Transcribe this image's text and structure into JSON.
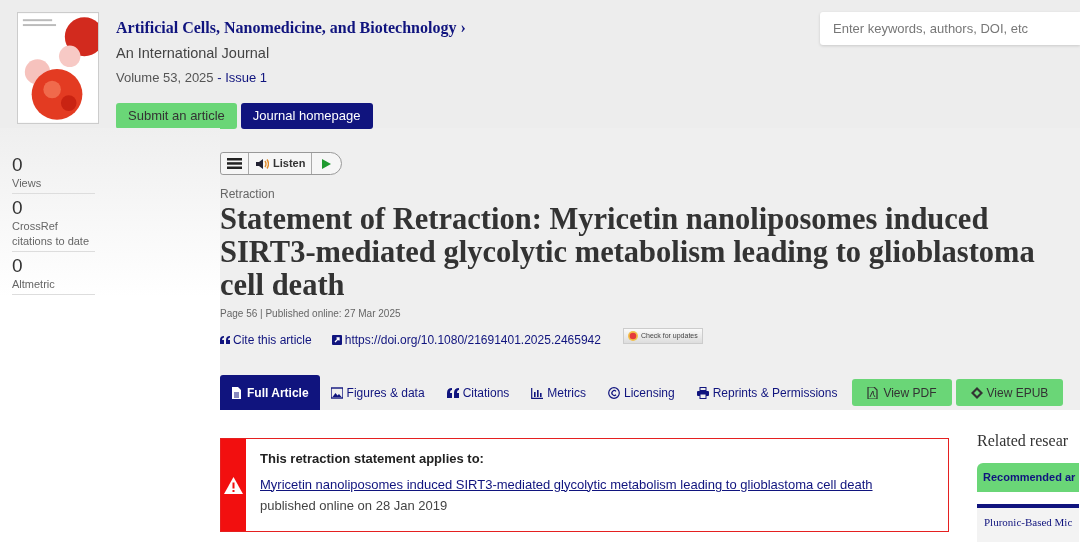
{
  "journal": {
    "title": "Artificial Cells, Nanomedicine, and Biotechnology",
    "chevron": "›",
    "subtitle": "An International Journal",
    "volume": "Volume 53, 2025",
    "issue": "- Issue 1",
    "buttons": [
      {
        "label": "Submit an article",
        "kind": "green"
      },
      {
        "label": "Journal homepage",
        "kind": "navy"
      }
    ]
  },
  "search": {
    "placeholder": "Enter keywords, authors, DOI, etc"
  },
  "metrics": [
    {
      "value": "0",
      "label": "Views"
    },
    {
      "value": "0",
      "label": "CrossRef citations to date"
    },
    {
      "value": "0",
      "label": "Altmetric"
    }
  ],
  "listen_bar": {
    "label": "Listen"
  },
  "article": {
    "type": "Retraction",
    "title": "Statement of Retraction: Myricetin nanoliposomes induced SIRT3-mediated glycolytic metabolism leading to glioblastoma cell death",
    "meta": "Page 56 | Published online: 27 Mar 2025",
    "cite": "Cite this article",
    "doi": "https://doi.org/10.1080/21691401.2025.2465942",
    "updates": "Check for updates"
  },
  "tabs": [
    {
      "label": "Full Article",
      "selected": true
    },
    {
      "label": "Figures & data",
      "selected": false
    },
    {
      "label": "Citations",
      "selected": false
    },
    {
      "label": "Metrics",
      "selected": false
    },
    {
      "label": "Licensing",
      "selected": false
    },
    {
      "label": "Reprints & Permissions",
      "selected": false
    }
  ],
  "actions": [
    {
      "label": "View PDF"
    },
    {
      "label": "View EPUB"
    }
  ],
  "notice": {
    "heading": "This retraction statement applies to:",
    "link": "Myricetin nanoliposomes induced SIRT3-mediated glycolytic metabolism leading to glioblastoma cell death",
    "published": "published online on 28 Jan 2019"
  },
  "related": {
    "heading": "Related resear",
    "tab": "Recommended ar",
    "items": [
      "Pluronic-Based Mic"
    ]
  }
}
